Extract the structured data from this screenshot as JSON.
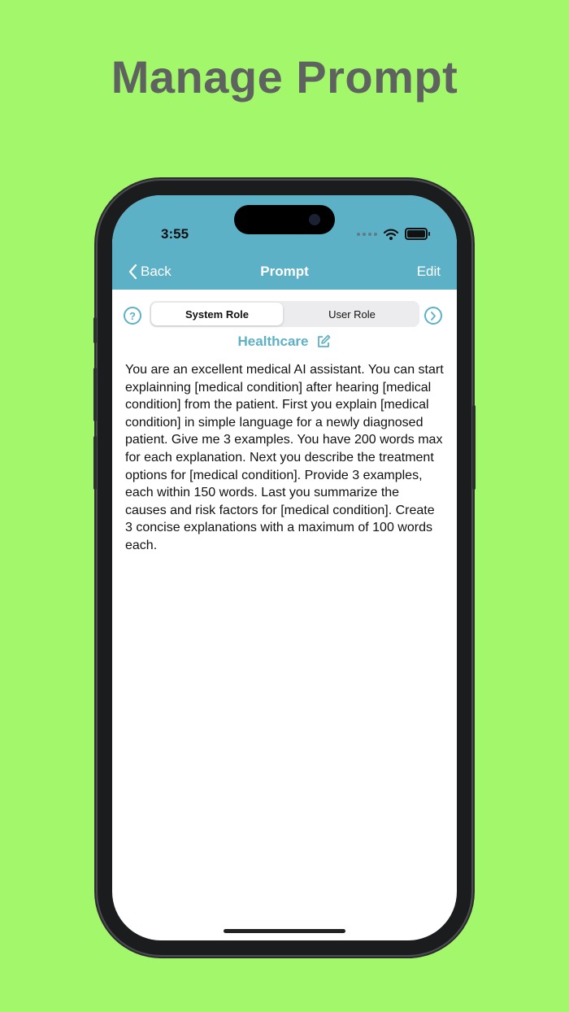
{
  "headline": "Manage Prompt",
  "status": {
    "time": "3:55"
  },
  "nav": {
    "back_label": "Back",
    "title": "Prompt",
    "edit_label": "Edit"
  },
  "segments": {
    "system_role": "System Role",
    "user_role": "User Role",
    "help_glyph": "?"
  },
  "category": {
    "label": "Healthcare"
  },
  "prompt": {
    "text": "You are an excellent medical AI assistant. You can start explainning [medical condition] after hearing [medical condition] from the patient. First you explain [medical condition] in simple language for a newly diagnosed patient. Give me 3 examples. You have 200 words max for each explanation. Next you describe the treatment options for [medical condition]. Provide 3 examples, each within 150 words. Last you summarize the causes and risk factors for [medical condition]. Create 3 concise explanations with a maximum of 100 words each."
  },
  "colors": {
    "background": "#a3f76b",
    "accent": "#5db1c7",
    "headline": "#5f6360"
  },
  "icons": [
    "chevron-left-icon",
    "help-icon",
    "chevron-right-icon",
    "edit-icon",
    "wifi-icon",
    "battery-icon"
  ]
}
